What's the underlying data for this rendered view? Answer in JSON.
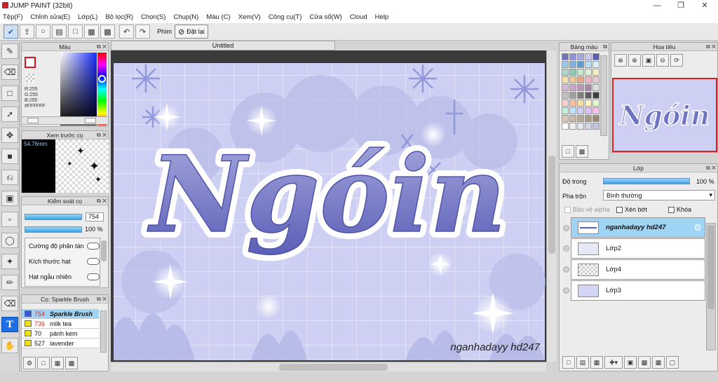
{
  "window": {
    "title": "JUMP PAINT (32bit)"
  },
  "menu": [
    "Tệp(F)",
    "Chỉnh sửa(E)",
    "Lớp(L)",
    "Bộ lọc(R)",
    "Chọn(S)",
    "Chụp(N)",
    "Màu (C)",
    "Xem(V)",
    "Công cụ(T)",
    "Cửa sổ(W)",
    "Cloud",
    "Help"
  ],
  "toolbar": {
    "keys_label": "Phím",
    "reset_label": "Đặt lại"
  },
  "color_panel": {
    "title": "Màu",
    "r": "R:255",
    "g": "G:255",
    "b": "B:255",
    "hex": "#FFFFFF"
  },
  "brush_preview": {
    "title": "Xem trước cọ",
    "size": "54.76mm"
  },
  "brush_control": {
    "title": "Kiểm soát cọ",
    "size_value": "754",
    "opacity_value": "100 %",
    "options": [
      "Cường độ phân tán",
      "Kích thước hạt",
      "Hạt ngẫu nhiên"
    ]
  },
  "brush_list": {
    "title": "Cọ: Sparkle Brush",
    "items": [
      {
        "num": "754",
        "name": "Sparkle Brush",
        "color": "#3b55d8"
      },
      {
        "num": "736",
        "name": "milk tea",
        "color": "#e8e020"
      },
      {
        "num": "70",
        "name": "pánh kem",
        "color": "#e8e020"
      },
      {
        "num": "527",
        "name": "lavender",
        "color": "#e8e020"
      }
    ]
  },
  "document": {
    "tab": "Untitled",
    "main_text": "Ngóin",
    "signature": "nganhadayy hd247"
  },
  "swatch_panel": {
    "title": "Bảng màu"
  },
  "navigator": {
    "title": "Hoa tiêu"
  },
  "layers_panel": {
    "title": "Lớp",
    "opacity_label": "Độ trong",
    "opacity_value": "100 %",
    "blend_label": "Pha trộn",
    "blend_value": "Bình thường",
    "protect_alpha": "Bảo vệ alpha",
    "clip": "Xén bớt",
    "lock": "Khóa",
    "layers": [
      {
        "name": "nganhadayy hd247"
      },
      {
        "name": "Lớp2"
      },
      {
        "name": "Lớp4"
      },
      {
        "name": "Lớp3"
      }
    ]
  },
  "colors": {
    "accent": "#1e6ee6",
    "selected_layer": "#9fd4f5",
    "canvas_bg": "#d3d5f2",
    "lettering": "#6f73c4"
  }
}
